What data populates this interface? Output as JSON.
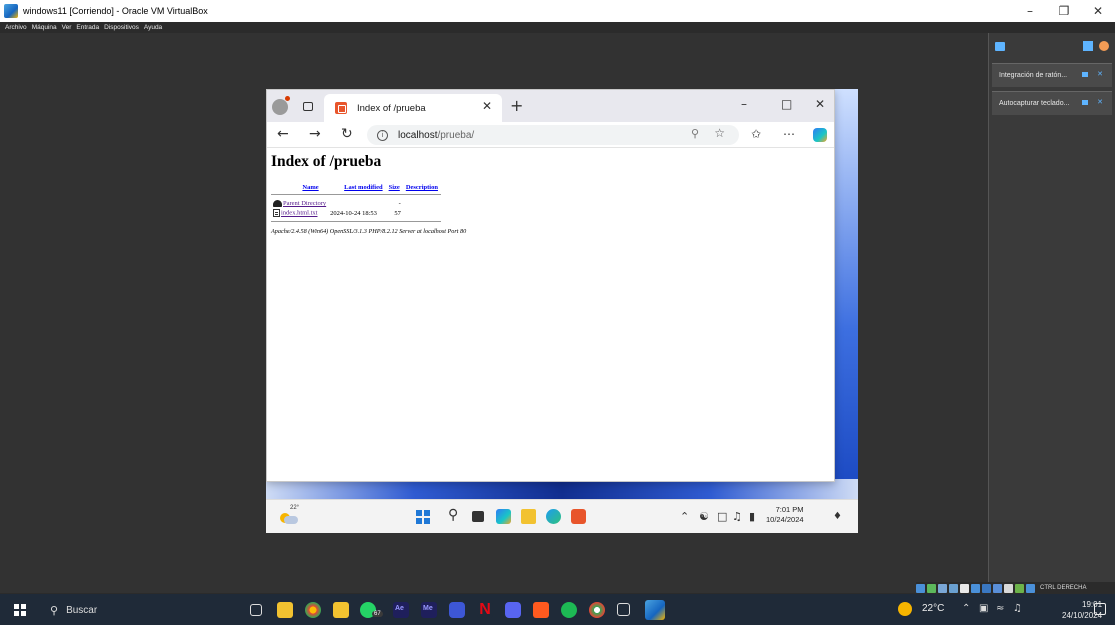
{
  "host": {
    "title": "windows11 [Corriendo] - Oracle VM VirtualBox",
    "menu": [
      "Archivo",
      "Máquina",
      "Ver",
      "Entrada",
      "Dispositivos",
      "Ayuda"
    ],
    "notifications": [
      "Integración de ratón...",
      "Autocapturar teclado..."
    ],
    "status_key": "CTRL DERECHA"
  },
  "browser": {
    "tab_title": "Index of /prueba",
    "url_host": "localhost",
    "url_path": "/prueba/"
  },
  "listing": {
    "heading": "Index of /prueba",
    "columns": [
      "Name",
      "Last modified",
      "Size",
      "Description"
    ],
    "rows": [
      {
        "name": "Parent Directory",
        "modified": "",
        "size": "-",
        "description": "",
        "icon": "back-icon"
      },
      {
        "name": "index.html.txt",
        "modified": "2024-10-24 18:53",
        "size": "57",
        "description": "",
        "icon": "text-file-icon"
      }
    ],
    "address": "Apache/2.4.58 (Win64) OpenSSL/3.1.3 PHP/8.2.12 Server at localhost Port 80"
  },
  "guest_taskbar": {
    "temperature": "22°",
    "time": "7:01 PM",
    "date": "10/24/2024"
  },
  "host_taskbar": {
    "search_label": "Buscar",
    "whatsapp_badge": "67",
    "ae_label": "Ae",
    "me_label": "Me",
    "temperature": "22°C",
    "time": "19:01",
    "date": "24/10/2024"
  },
  "colors": {
    "link": "#0000ee",
    "visited_link": "#551a8b",
    "host_taskbar": "#1f2a38",
    "accent": "#1f78d6"
  }
}
